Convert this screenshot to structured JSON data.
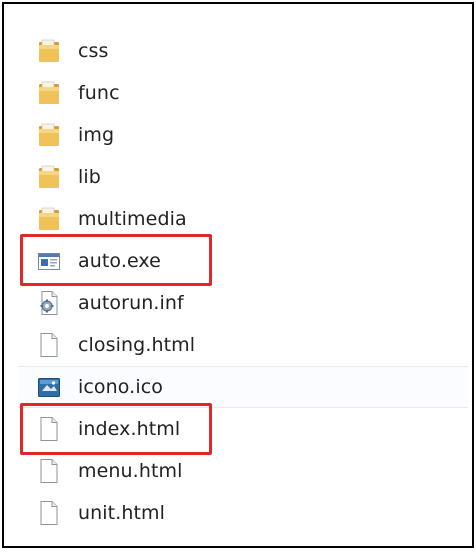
{
  "explorer": {
    "items": [
      {
        "name": "css",
        "icon": "folder-icon"
      },
      {
        "name": "func",
        "icon": "folder-icon"
      },
      {
        "name": "img",
        "icon": "folder-icon"
      },
      {
        "name": "lib",
        "icon": "folder-icon"
      },
      {
        "name": "multimedia",
        "icon": "folder-icon"
      },
      {
        "name": "auto.exe",
        "icon": "application-icon"
      },
      {
        "name": "autorun.inf",
        "icon": "settings-file-icon"
      },
      {
        "name": "closing.html",
        "icon": "document-icon"
      },
      {
        "name": "icono.ico",
        "icon": "image-ico-icon"
      },
      {
        "name": "index.html",
        "icon": "document-icon"
      },
      {
        "name": "menu.html",
        "icon": "document-icon"
      },
      {
        "name": "unit.html",
        "icon": "document-icon"
      }
    ],
    "highlighted": [
      "auto.exe",
      "index.html"
    ]
  },
  "colors": {
    "highlight": "#e02828",
    "folder": "#e8b64a",
    "selection": "#e2ebf5"
  }
}
